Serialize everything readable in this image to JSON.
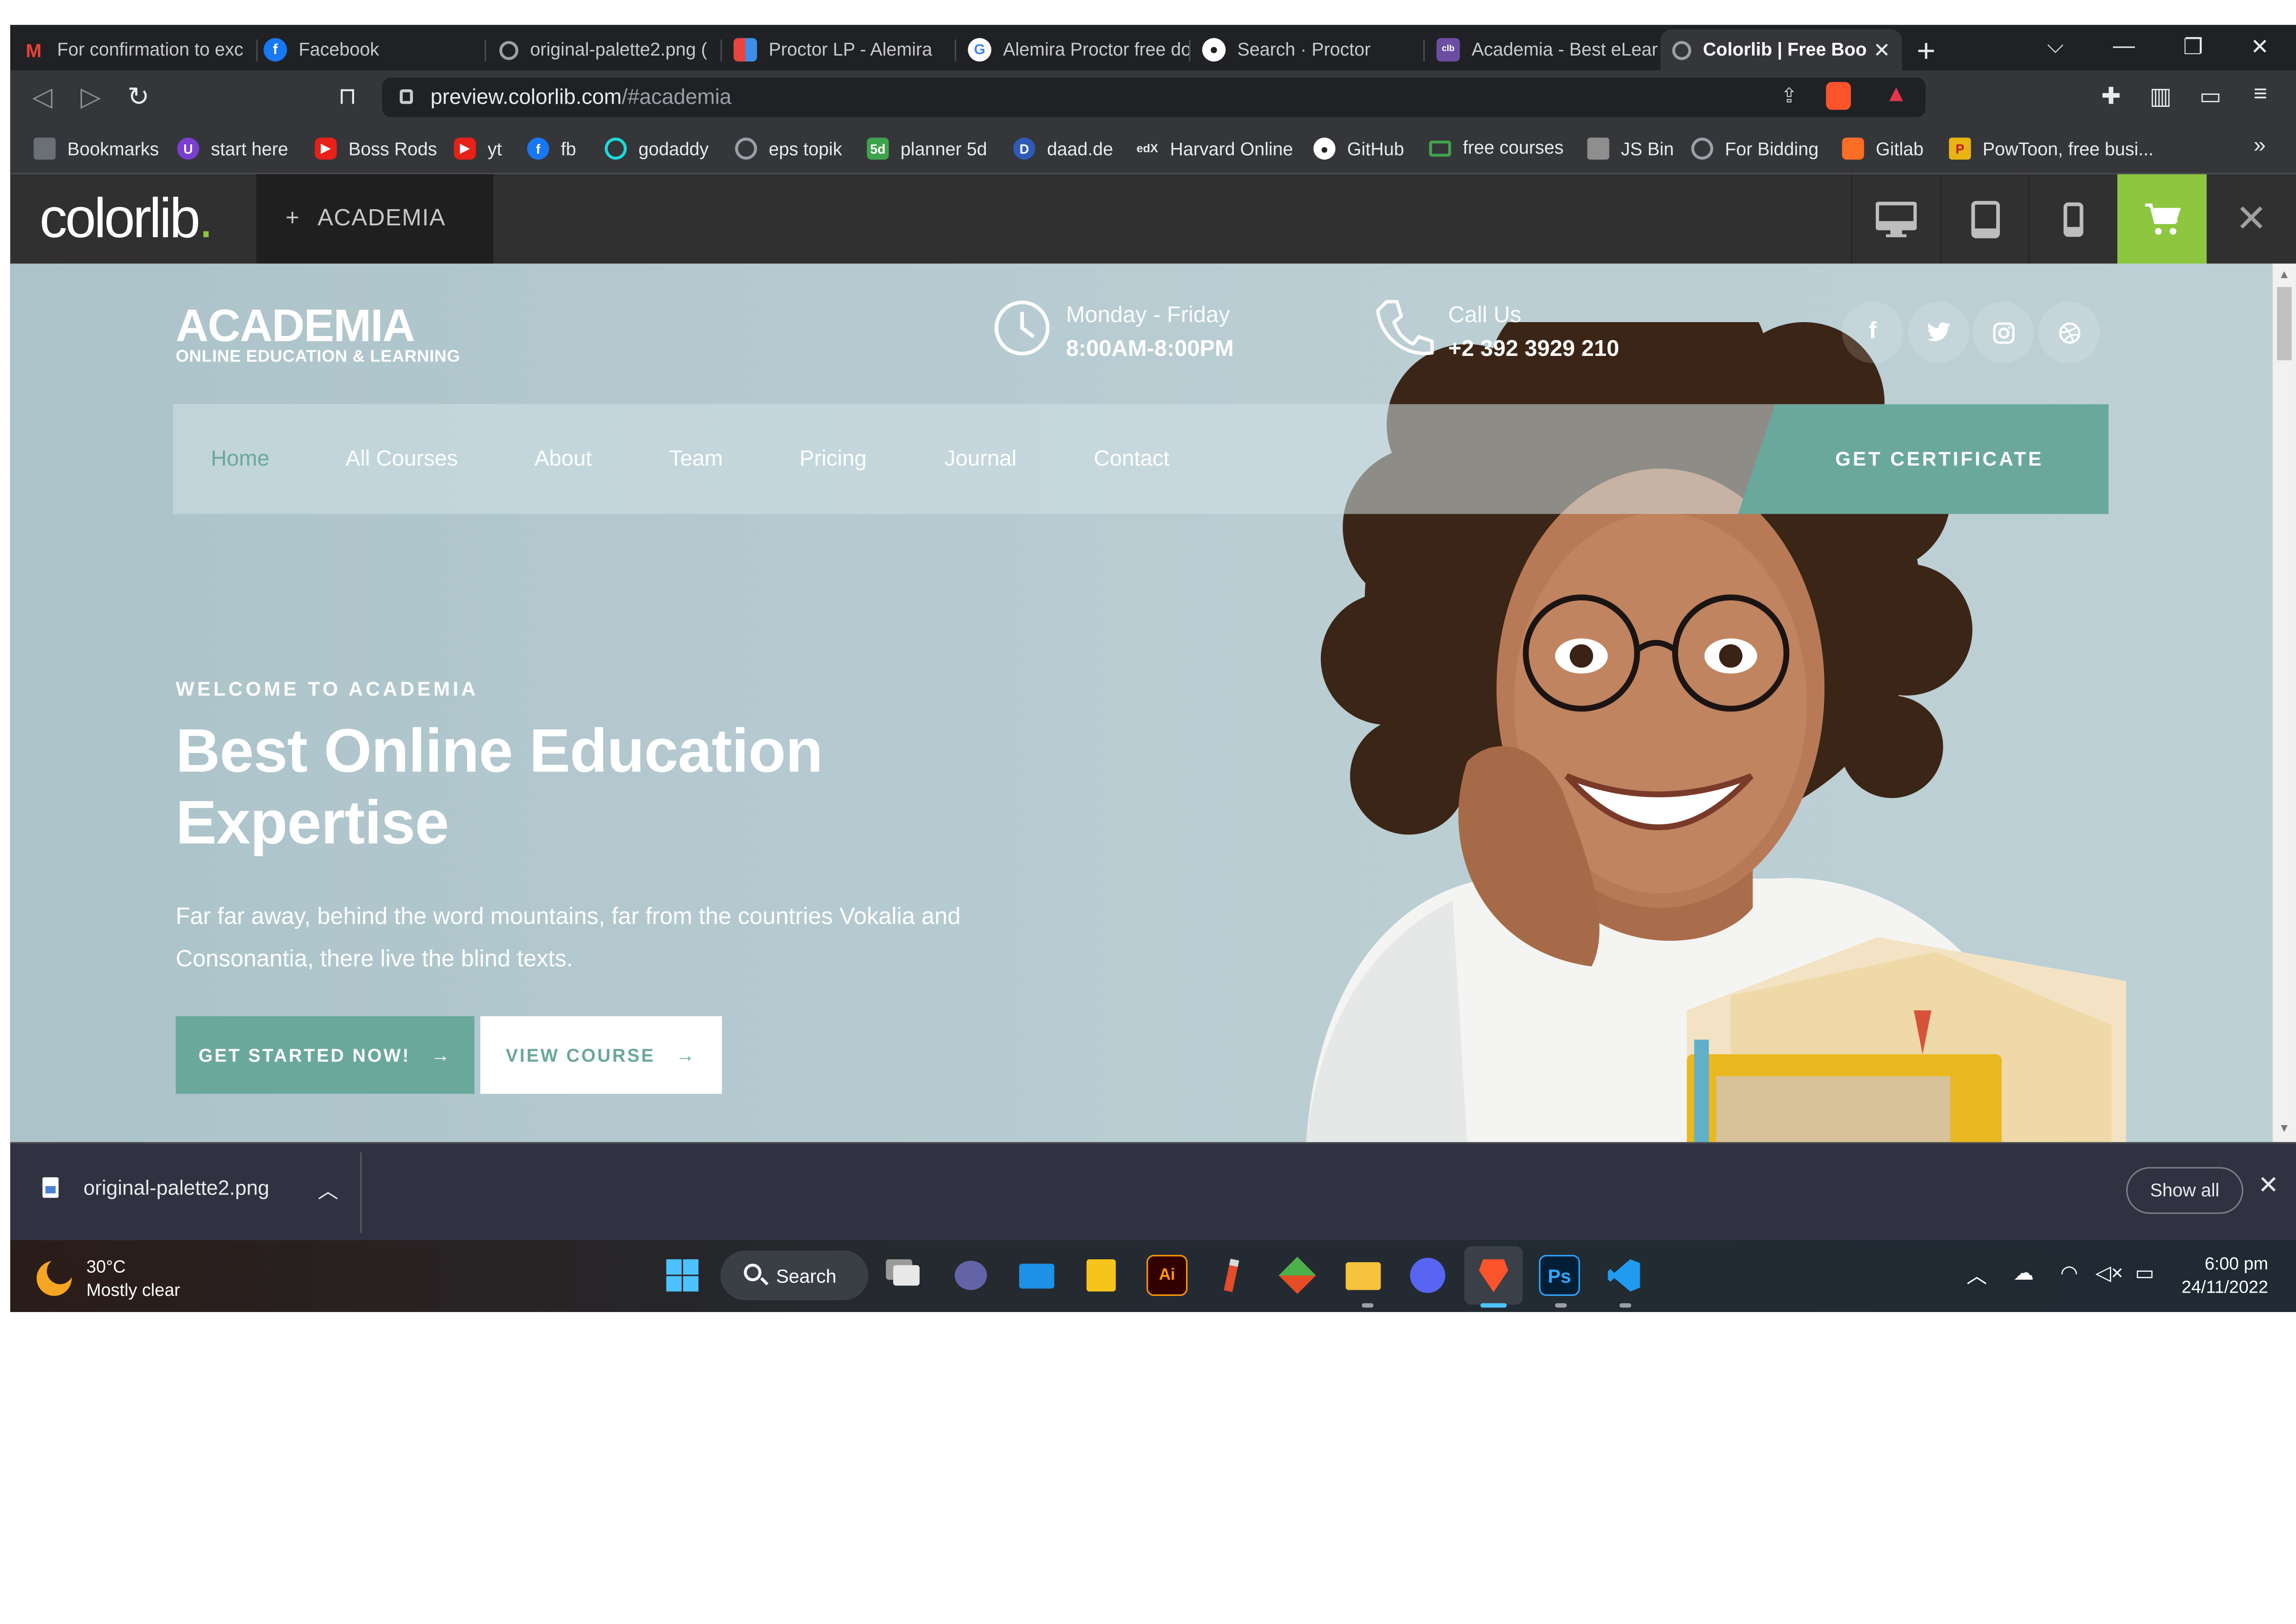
{
  "browser": {
    "tabs": [
      {
        "title": "For confirmation to exc",
        "icon": "gmail-icon",
        "color": "#ea4335"
      },
      {
        "title": "Facebook",
        "icon": "facebook-icon",
        "color": "#1877f2"
      },
      {
        "title": "original-palette2.png (",
        "icon": "globe-icon",
        "color": "#9aa0a6"
      },
      {
        "title": "Proctor LP - Alemira",
        "icon": "proctor-icon",
        "color": "#ffffff"
      },
      {
        "title": "Alemira Proctor free do",
        "icon": "google-icon",
        "color": "#ffffff"
      },
      {
        "title": "Search · Proctor",
        "icon": "github-icon",
        "color": "#ffffff"
      },
      {
        "title": "Academia - Best eLearn",
        "icon": "colorlib-icon",
        "color": "#6b4ea2"
      },
      {
        "title": "Colorlib | Free Boo",
        "icon": "globe-icon",
        "color": "#9aa0a6",
        "active": true
      }
    ],
    "address": {
      "host": "preview.colorlib.com",
      "path": "/#academia"
    },
    "bookmarks": [
      {
        "label": "Bookmarks",
        "icon": "bookmarks-folder-icon",
        "color": "#6b6f76"
      },
      {
        "label": "start here",
        "icon": "start-here-icon",
        "color": "#7a3fd1"
      },
      {
        "label": "Boss Rods",
        "icon": "youtube-icon",
        "color": "#e62117"
      },
      {
        "label": "yt",
        "icon": "youtube-icon",
        "color": "#e62117"
      },
      {
        "label": "fb",
        "icon": "facebook-icon",
        "color": "#1877f2"
      },
      {
        "label": "godaddy",
        "icon": "godaddy-icon",
        "color": "#1bdbdb"
      },
      {
        "label": "eps topik",
        "icon": "globe-icon",
        "color": "#6b6f76"
      },
      {
        "label": "planner 5d",
        "icon": "planner5d-icon",
        "color": "#3fa34d"
      },
      {
        "label": "daad.de",
        "icon": "daad-icon",
        "color": "#2f5bb7"
      },
      {
        "label": "Harvard Online",
        "icon": "edx-icon",
        "color": "#35363a"
      },
      {
        "label": "GitHub",
        "icon": "github-icon",
        "color": "#35363a"
      },
      {
        "label": "free courses",
        "icon": "laptop-icon",
        "color": "#3fa34d"
      },
      {
        "label": "JS Bin",
        "icon": "jsbin-icon",
        "color": "#8e8e8e"
      },
      {
        "label": "For Bidding",
        "icon": "globe-icon",
        "color": "#6b6f76"
      },
      {
        "label": "Gitlab",
        "icon": "gitlab-icon",
        "color": "#fc6d26"
      },
      {
        "label": "PowToon, free busi...",
        "icon": "powtoon-icon",
        "color": "#e9b413"
      }
    ],
    "bookmarks_overflow": "»"
  },
  "colorlib_bar": {
    "logo": "colorlib",
    "logo_dot": ".",
    "theme_label": "ACADEMIA",
    "theme_plus": "+",
    "accent": "#8dc63f",
    "close": "✕"
  },
  "site": {
    "brand": {
      "title": "ACADEMIA",
      "subtitle": "ONLINE EDUCATION & LEARNING"
    },
    "hours": {
      "label": "Monday - Friday",
      "value": "8:00AM-8:00PM"
    },
    "call": {
      "label": "Call Us",
      "value": "+2 392 3929 210"
    },
    "social": [
      "facebook-icon",
      "twitter-icon",
      "instagram-icon",
      "dribbble-icon"
    ],
    "nav": [
      "Home",
      "All Courses",
      "About",
      "Team",
      "Pricing",
      "Journal",
      "Contact"
    ],
    "nav_active": "Home",
    "cta": "GET CERTIFICATE",
    "hero": {
      "eyebrow": "WELCOME TO ACADEMIA",
      "headline": "Best Online Education Expertise",
      "lede": "Far far away, behind the word mountains, far from the countries Vokalia and Consonantia, there live the blind texts.",
      "primary_button": "GET STARTED NOW!",
      "secondary_button": "VIEW COURSE",
      "arrow": "→"
    },
    "accent": "#6aa89b"
  },
  "downloads": {
    "file": "original-palette2.png",
    "chevron": "︿",
    "show_all": "Show all",
    "close": "✕"
  },
  "taskbar": {
    "weather": {
      "temp": "30°C",
      "condition": "Mostly clear"
    },
    "search": "Search",
    "clock": {
      "time": "6:00 pm",
      "date": "24/11/2022"
    },
    "apps": [
      "windows-start-icon",
      "task-view-icon",
      "teams-chat-icon",
      "mail-icon",
      "sticky-notes-icon",
      "illustrator-icon",
      "pencil-icon",
      "git-icon",
      "file-explorer-icon",
      "discord-icon",
      "brave-icon",
      "photoshop-icon",
      "vscode-icon"
    ],
    "illustrator_label": "Ai",
    "photoshop_label": "Ps"
  }
}
